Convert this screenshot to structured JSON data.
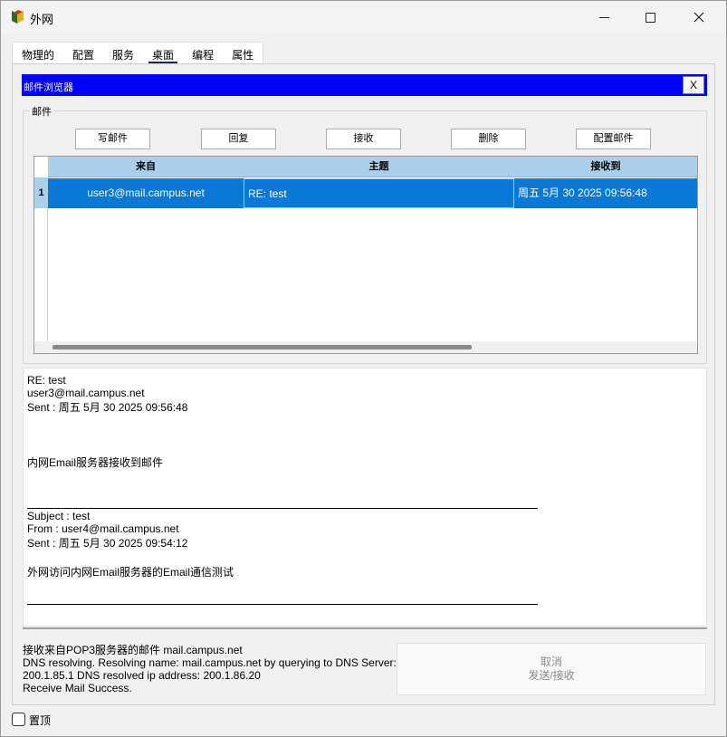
{
  "window": {
    "title": "外网",
    "min_label": "",
    "max_label": "",
    "close_label": ""
  },
  "tabs": [
    {
      "label": "物理的"
    },
    {
      "label": "配置"
    },
    {
      "label": "服务"
    },
    {
      "label": "桌面",
      "active": true
    },
    {
      "label": "编程"
    },
    {
      "label": "属性"
    }
  ],
  "browser": {
    "title": "邮件浏览器",
    "close_label": "X"
  },
  "mail_group": {
    "label": "邮件",
    "buttons": {
      "compose": "写邮件",
      "reply": "回复",
      "receive": "接收",
      "delete": "删除",
      "configure": "配置邮件"
    }
  },
  "table": {
    "headers": {
      "from": "来自",
      "subject": "主题",
      "received": "接收到"
    },
    "rows": [
      {
        "num": "1",
        "from": "user3@mail.campus.net",
        "subject": "RE: test",
        "received": "周五 5月 30 2025 09:56:48"
      }
    ]
  },
  "preview": {
    "subject": "RE: test",
    "from": "user3@mail.campus.net",
    "sent": "Sent : 周五 5月 30 2025 09:56:48",
    "body": "内网Email服务器接收到邮件",
    "quoted_subject": "Subject : test",
    "quoted_from": "From : user4@mail.campus.net",
    "quoted_sent": "Sent : 周五 5月 30 2025 09:54:12",
    "quoted_body": "外网访问内网Email服务器的Email通信测试"
  },
  "status": {
    "line1": "接收来自POP3服务器的邮件 mail.campus.net",
    "line2": "DNS resolving. Resolving name: mail.campus.net by querying to DNS Server:",
    "line3": "200.1.85.1  DNS resolved ip address: 200.1.86.20",
    "line4": "Receive Mail Success."
  },
  "cancel_button": {
    "line1": "取消",
    "line2": "发送/接收"
  },
  "always_on_top": {
    "label": "置顶",
    "checked": false
  },
  "colors": {
    "header_bar": "#0000ff",
    "selected_row": "#0a78d7",
    "table_header": "#a9cfea"
  }
}
